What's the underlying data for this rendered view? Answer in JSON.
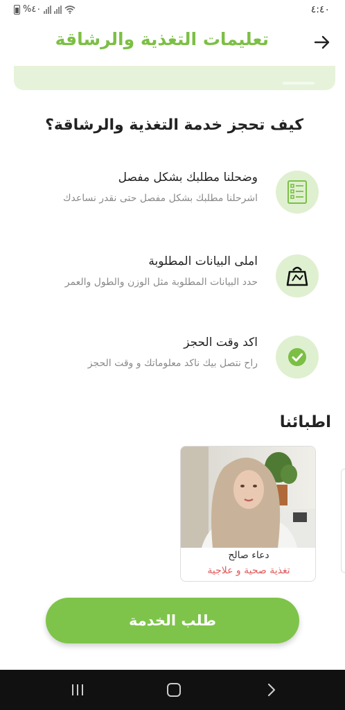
{
  "status_bar": {
    "time": "٤:٤٠",
    "battery": "%٤٠"
  },
  "header": {
    "title": "تعليمات التغذية والرشاقة",
    "back_icon": "arrow-icon"
  },
  "section_title": "كيف تحجز خدمة التغذية والرشاقة؟",
  "steps": [
    {
      "title": "وضحلنا مطلبك بشكل مفصل",
      "description": "اشرحلنا مطلبك بشكل مفصل حتى نقدر نساعدك",
      "icon": "checklist-icon"
    },
    {
      "title": "املى البيانات المطلوبة",
      "description": "حدد البيانات المطلوبة مثل الوزن والطول والعمر",
      "icon": "scale-icon"
    },
    {
      "title": "اكد وقت الحجز",
      "description": "راح نتصل بيك ناكد معلوماتك و وقت الحجز",
      "icon": "check-circle-icon"
    }
  ],
  "doctors_title": "اطبائنا",
  "doctors": [
    {
      "name": "دعاء صالح",
      "specialty": "تغذية صحية و علاجية"
    }
  ],
  "cta_label": "طلب الخدمة",
  "colors": {
    "brand_green": "#7cbf45",
    "light_green": "#dff0d1",
    "specialty_red": "#e05a5a"
  }
}
